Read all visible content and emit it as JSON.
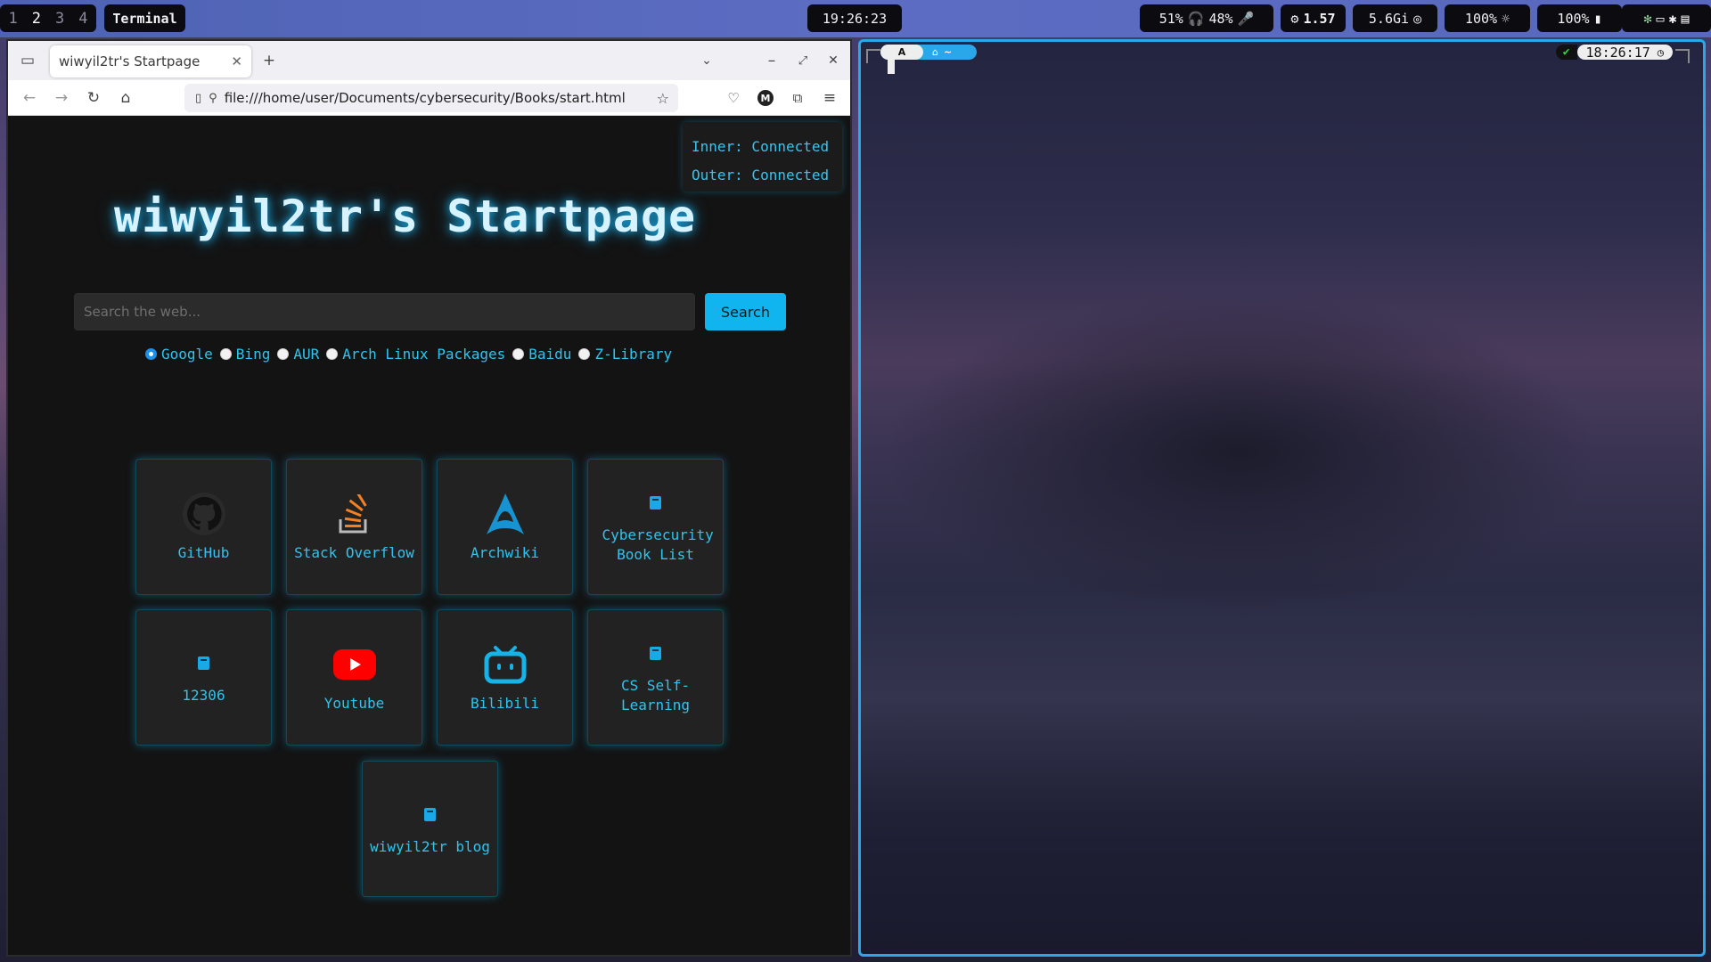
{
  "topbar": {
    "workspaces": [
      "1",
      "2",
      "3",
      "4"
    ],
    "active_workspace": "2",
    "window_title": "Terminal",
    "clock": "19:26:23",
    "volume": "51%",
    "headphone": "48%",
    "load": "1.57",
    "memory": "5.6Gi",
    "brightness": "100%",
    "battery": "100%"
  },
  "browser": {
    "tab_title": "wiwyil2tr's Startpage",
    "url": "file:///home/user/Documents/cybersecurity/Books/start.html"
  },
  "page": {
    "status": {
      "inner": "Inner: Connected",
      "outer": "Outer: Connected"
    },
    "title": "wiwyil2tr's Startpage",
    "search": {
      "placeholder": "Search the web...",
      "button": "Search"
    },
    "engines": [
      "Google",
      "Bing",
      "AUR",
      "Arch Linux Packages",
      "Baidu",
      "Z-Library"
    ],
    "selected_engine": "Google",
    "bookmarks": [
      {
        "label": "GitHub",
        "icon": "github-icon"
      },
      {
        "label": "Stack Overflow",
        "icon": "stackoverflow-icon"
      },
      {
        "label": "Archwiki",
        "icon": "arch-icon"
      },
      {
        "label": "Cybersecurity Book List",
        "icon": "book-icon"
      },
      {
        "label": "12306",
        "icon": "book-icon"
      },
      {
        "label": "Youtube",
        "icon": "youtube-icon"
      },
      {
        "label": "Bilibili",
        "icon": "bilibili-icon"
      },
      {
        "label": "CS Self-Learning",
        "icon": "book-icon"
      },
      {
        "label": "wiwyil2tr blog",
        "icon": "book-icon"
      }
    ]
  },
  "terminal": {
    "prompt_user": "A",
    "prompt_dir": "~",
    "check": "✔",
    "time": "18:26:17"
  },
  "colors": {
    "accent": "#2ec4ef",
    "search_button": "#10b5ef",
    "terminal_border": "#2aa7e8"
  }
}
